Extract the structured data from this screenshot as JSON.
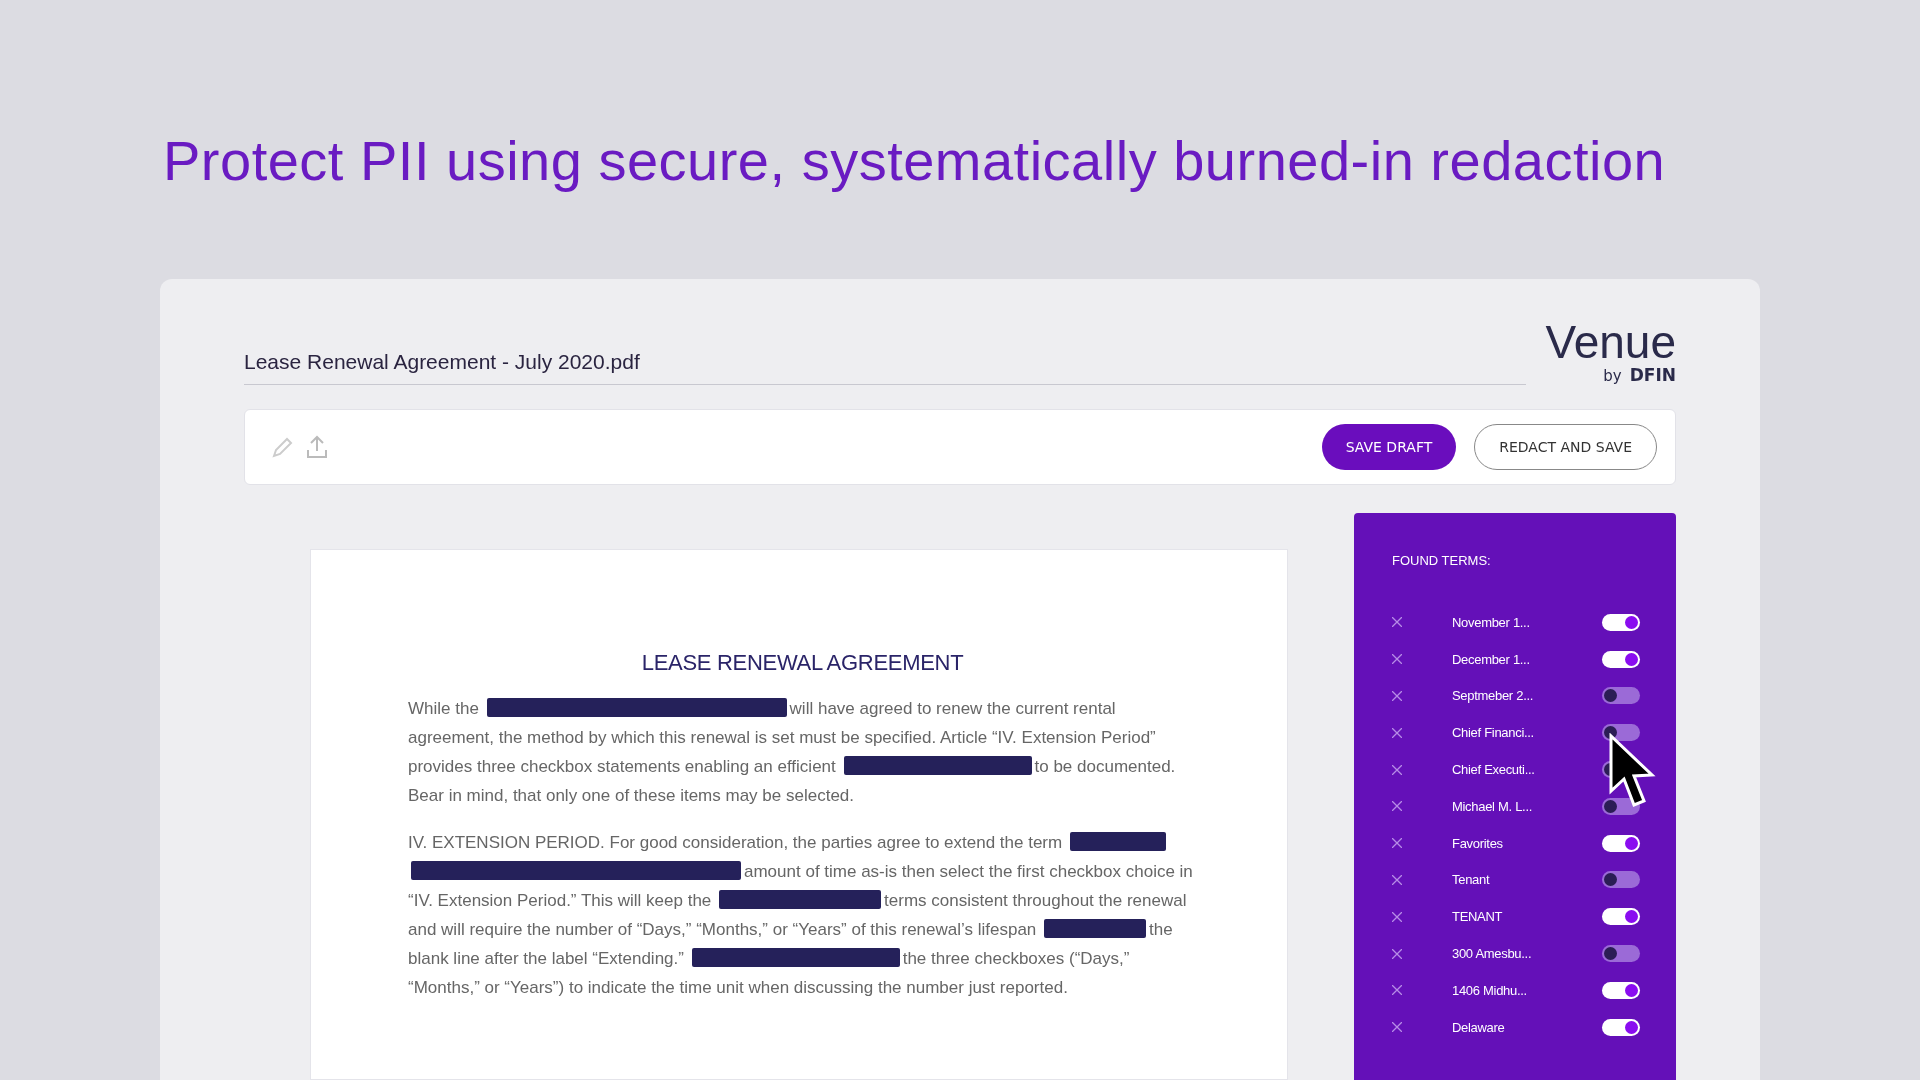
{
  "headline": "Protect PII using secure, systematically burned-in redaction",
  "file_name": "Lease Renewal Agreement - July 2020.pdf",
  "logo": {
    "name": "Venue",
    "by": "by",
    "brand": "DFIN"
  },
  "toolbar": {
    "buttons": [
      {
        "label": "SAVE DRAFT",
        "kind": "primary"
      },
      {
        "label": "REDACT AND SAVE",
        "kind": "outline"
      }
    ]
  },
  "document": {
    "title": "LEASE RENEWAL AGREEMENT",
    "paragraphs": [
      [
        {
          "kind": "text",
          "text": "While the"
        },
        {
          "kind": "redaction"
        },
        {
          "kind": "text",
          "text": "will have agreed to renew the current rental agreement, the method by which this renewal is set must be specified. Article “IV. Extension Period” provides three checkbox statements enabling an efficient"
        },
        {
          "kind": "redaction"
        },
        {
          "kind": "text",
          "text": "to be documented. Bear in mind, that only one of these items may be selected."
        }
      ],
      [
        {
          "kind": "text",
          "text": "IV. EXTENSION PERIOD. For good consideration, the parties agree to extend the term"
        },
        {
          "kind": "redaction"
        },
        {
          "kind": "redaction"
        },
        {
          "kind": "text",
          "text": "amount of time as-is then select the first checkbox choice in “IV. Extension Period.” This will keep the"
        },
        {
          "kind": "redaction"
        },
        {
          "kind": "text",
          "text": "terms consistent throughout the renewal and will require the number of “Days,” “Months,” or “Years” of this renewal’s lifespan"
        },
        {
          "kind": "redaction"
        },
        {
          "kind": "text",
          "text": "the blank line after the label “Extending.”"
        },
        {
          "kind": "redaction"
        },
        {
          "kind": "text",
          "text": "the three checkboxes (“Days,” “Months,” or “Years”) to indicate the time unit when discussing the number just reported."
        }
      ]
    ]
  },
  "found_terms": {
    "title": "FOUND TERMS:",
    "items": [
      {
        "label": "November 1...",
        "on": true
      },
      {
        "label": "December 1...",
        "on": true
      },
      {
        "label": "Septmeber 2...",
        "on": false
      },
      {
        "label": "Chief Financi...",
        "on": false
      },
      {
        "label": "Chief Executi...",
        "on": false
      },
      {
        "label": "Michael M. L...",
        "on": false
      },
      {
        "label": "Favorites",
        "on": true
      },
      {
        "label": "Tenant",
        "on": false
      },
      {
        "label": "TENANT",
        "on": true
      },
      {
        "label": "300 Amesbu...",
        "on": false
      },
      {
        "label": "1406 Midhu...",
        "on": true
      },
      {
        "label": "Delaware",
        "on": true
      }
    ]
  }
}
